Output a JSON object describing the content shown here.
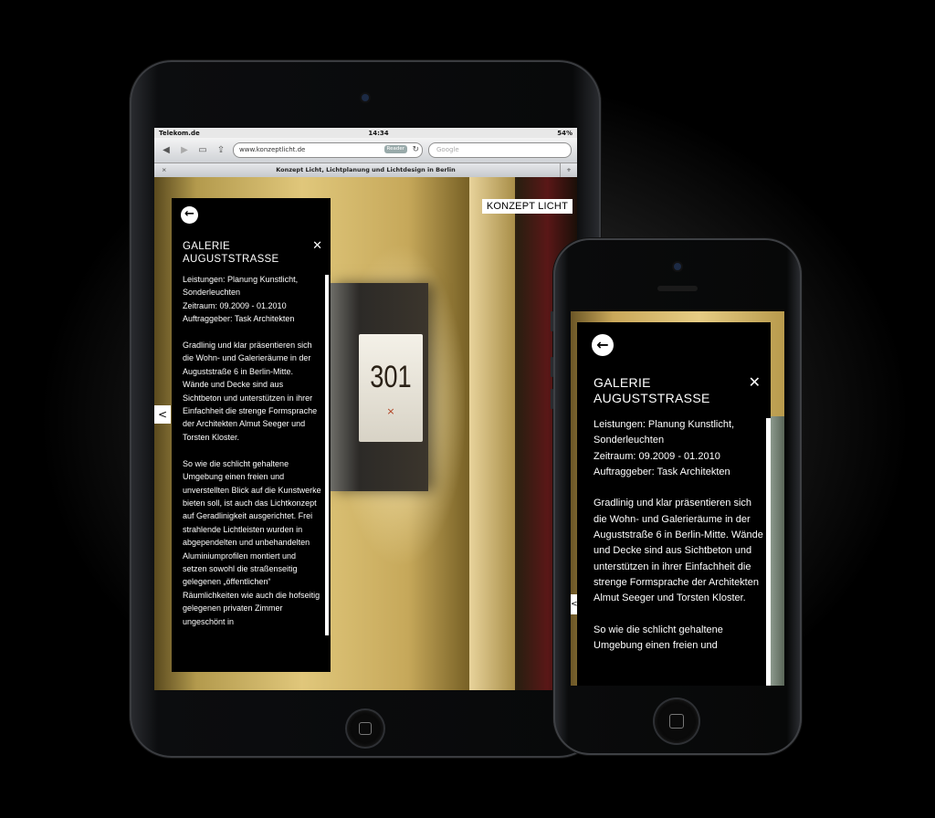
{
  "tablet": {
    "status": {
      "carrier": "Telekom.de",
      "time": "14:34",
      "battery": "54%"
    },
    "toolbar": {
      "back_icon": "back-arrow-icon",
      "forward_icon": "forward-arrow-icon",
      "bookmarks_icon": "book-icon",
      "share_icon": "share-icon",
      "url": "www.konzeptlicht.de",
      "reader_label": "Reader",
      "reload_icon": "reload-icon",
      "search_placeholder": "Google"
    },
    "tab": {
      "title": "Konzept Licht, Lichtplanung und Lichtdesign in Berlin",
      "close": "×",
      "new": "+"
    },
    "brand": "KONZEPT LICHT",
    "sign": {
      "number": "301",
      "mark": "×"
    },
    "panel": {
      "back": "←",
      "title": "GALERIE AUGUSTSTRASSE",
      "close": "✕",
      "text": "Leistungen: Planung Kunstlicht, Sonderleuchten\nZeitraum: 09.2009 - 01.2010\nAuftraggeber: Task Architekten\n\nGradlinig und klar präsentieren sich die Wohn- und Galerieräume in der Auguststraße 6 in Berlin-Mitte. Wände und Decke sind aus Sichtbeton und unterstützen in ihrer Einfachheit die strenge Formsprache der Architekten Almut Seeger und Torsten Kloster.\n\nSo wie die schlicht gehaltene Umgebung einen freien und unverstellten Blick auf die Kunstwerke bieten soll, ist auch das Lichtkonzept auf Geradlinigkeit ausgerichtet. Frei strahlende Lichtleisten wurden in abgependelten und unbehandelten Aluminiumprofilen montiert und setzen sowohl die straßenseitig gelegenen „öffentlichen“ Räumlichkeiten wie auch die hofseitig gelegenen privaten Zimmer ungeschönt in",
      "prev_arrow": "<"
    }
  },
  "phone": {
    "panel": {
      "back": "←",
      "title": "GALERIE AUGUSTSTRASSE",
      "close": "✕",
      "text": "Leistungen: Planung Kunstlicht, Sonderleuchten\nZeitraum: 09.2009 - 01.2010\nAuftraggeber: Task Architekten\n\nGradlinig und klar präsentieren sich die Wohn- und Galerieräume in der Auguststraße 6 in Berlin-Mitte. Wände und Decke sind aus Sichtbeton und unterstützen in ihrer Einfachheit die strenge Formsprache der Architekten Almut Seeger und Torsten Kloster.\n\nSo wie die schlicht gehaltene Umgebung einen freien und",
      "prev_arrow": "<"
    }
  },
  "colors": {
    "background": "#000000",
    "panel": "#000000",
    "text": "#ffffff",
    "wall_gold": "#e0c77b"
  }
}
